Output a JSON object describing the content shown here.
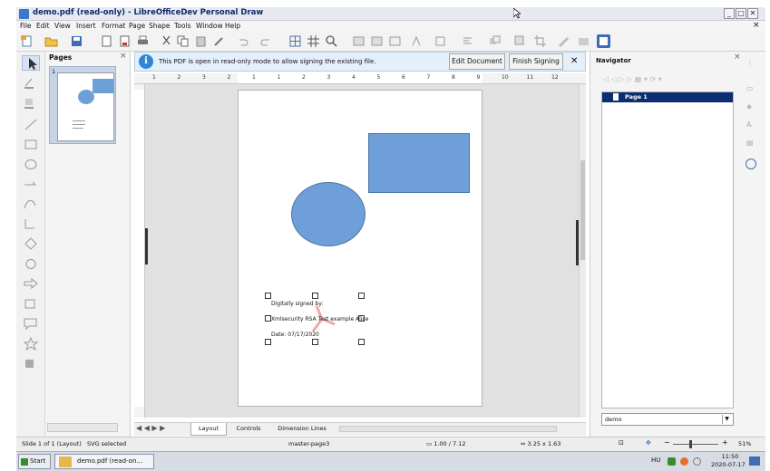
{
  "window": {
    "title": "demo.pdf (read-only) - LibreOfficeDev Personal Draw",
    "min": "_",
    "max": "□",
    "close": "✕",
    "doc_close": "×"
  },
  "menu": [
    "File",
    "Edit",
    "View",
    "Insert",
    "Format",
    "Page",
    "Shape",
    "Tools",
    "Window",
    "Help"
  ],
  "pages_panel": {
    "title": "Pages",
    "page_number": "1",
    "close": "×"
  },
  "infobar": {
    "message": "This PDF is open in read-only mode to allow signing the existing file.",
    "edit_button": "Edit Document",
    "finish_button": "Finish Signing",
    "close": "✕"
  },
  "ruler": {
    "numbers": [
      "1",
      "2",
      "3",
      "2",
      "1",
      "1",
      "2",
      "3",
      "4",
      "5",
      "6",
      "7",
      "8",
      "9",
      "10",
      "11",
      "12"
    ]
  },
  "signature": {
    "line1": "Digitally signed by:",
    "line2": "Xmlsecurity RSA Test example Alice",
    "line3": "Date: 07/17/2020"
  },
  "navigator": {
    "title": "Navigator",
    "item": "Page 1",
    "dropdown_value": "demo",
    "close": "×"
  },
  "tabs": [
    "Layout",
    "Controls",
    "Dimension Lines"
  ],
  "status": {
    "slide": "Slide 1 of 1 (Layout)",
    "selection": "SVG selected",
    "master": "master-page3",
    "position": "1.00 / 7.12",
    "size": "3.25 x 1.63",
    "zoom": "51%",
    "zoom_minus": "−",
    "zoom_plus": "+"
  },
  "taskbar": {
    "start": "Start",
    "app": "demo.pdf (read-on...",
    "lang": "HU",
    "time": "11:50",
    "date": "2020-07-17"
  },
  "colors": {
    "shape_fill": "#6f9fd8",
    "shape_stroke": "#4a74a8",
    "selection": "#0b2d72",
    "info_bg": "#e4effa"
  }
}
